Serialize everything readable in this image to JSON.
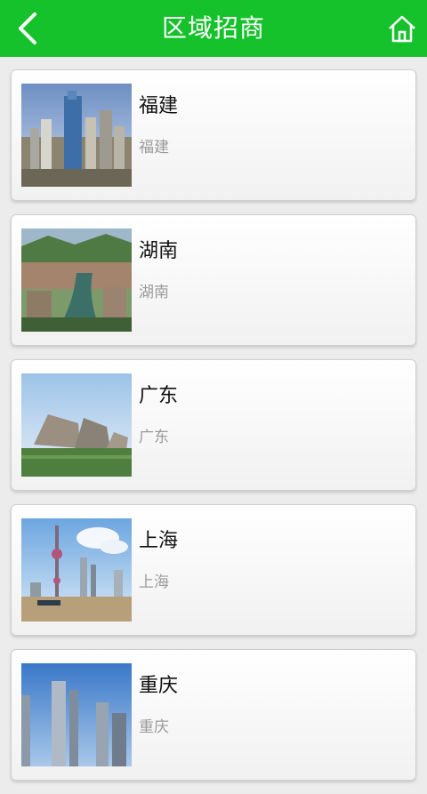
{
  "header": {
    "title": "区域招商",
    "back_icon": "chevron-left-icon",
    "home_icon": "home-icon",
    "background": "#16c22c"
  },
  "regions": [
    {
      "title": "福建",
      "subtitle": "福建"
    },
    {
      "title": "湖南",
      "subtitle": "湖南"
    },
    {
      "title": "广东",
      "subtitle": "广东"
    },
    {
      "title": "上海",
      "subtitle": "上海"
    },
    {
      "title": "重庆",
      "subtitle": "重庆"
    }
  ]
}
